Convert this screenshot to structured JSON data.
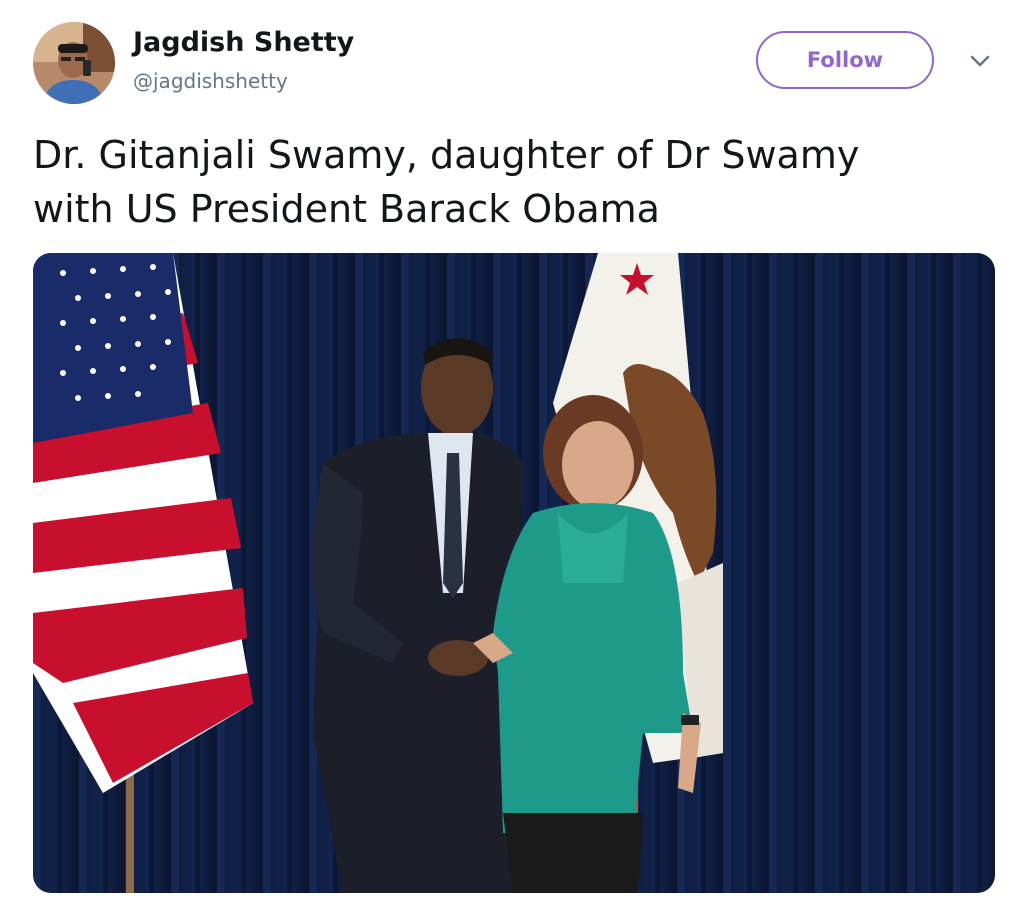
{
  "tweet": {
    "author": {
      "display_name": "Jagdish Shetty",
      "handle": "@jagdishshetty",
      "avatar_icon": "user-avatar-photo"
    },
    "follow_label": "Follow",
    "menu_icon": "chevron-down-icon",
    "text_lines": [
      "Dr. Gitanjali Swamy,  daughter of Dr Swamy",
      "with US President Barack Obama"
    ],
    "media": {
      "type": "photo"
    }
  },
  "colors": {
    "follow_accent": "#9266cc",
    "handle_gray": "#657786",
    "text_dark": "#14171a"
  }
}
